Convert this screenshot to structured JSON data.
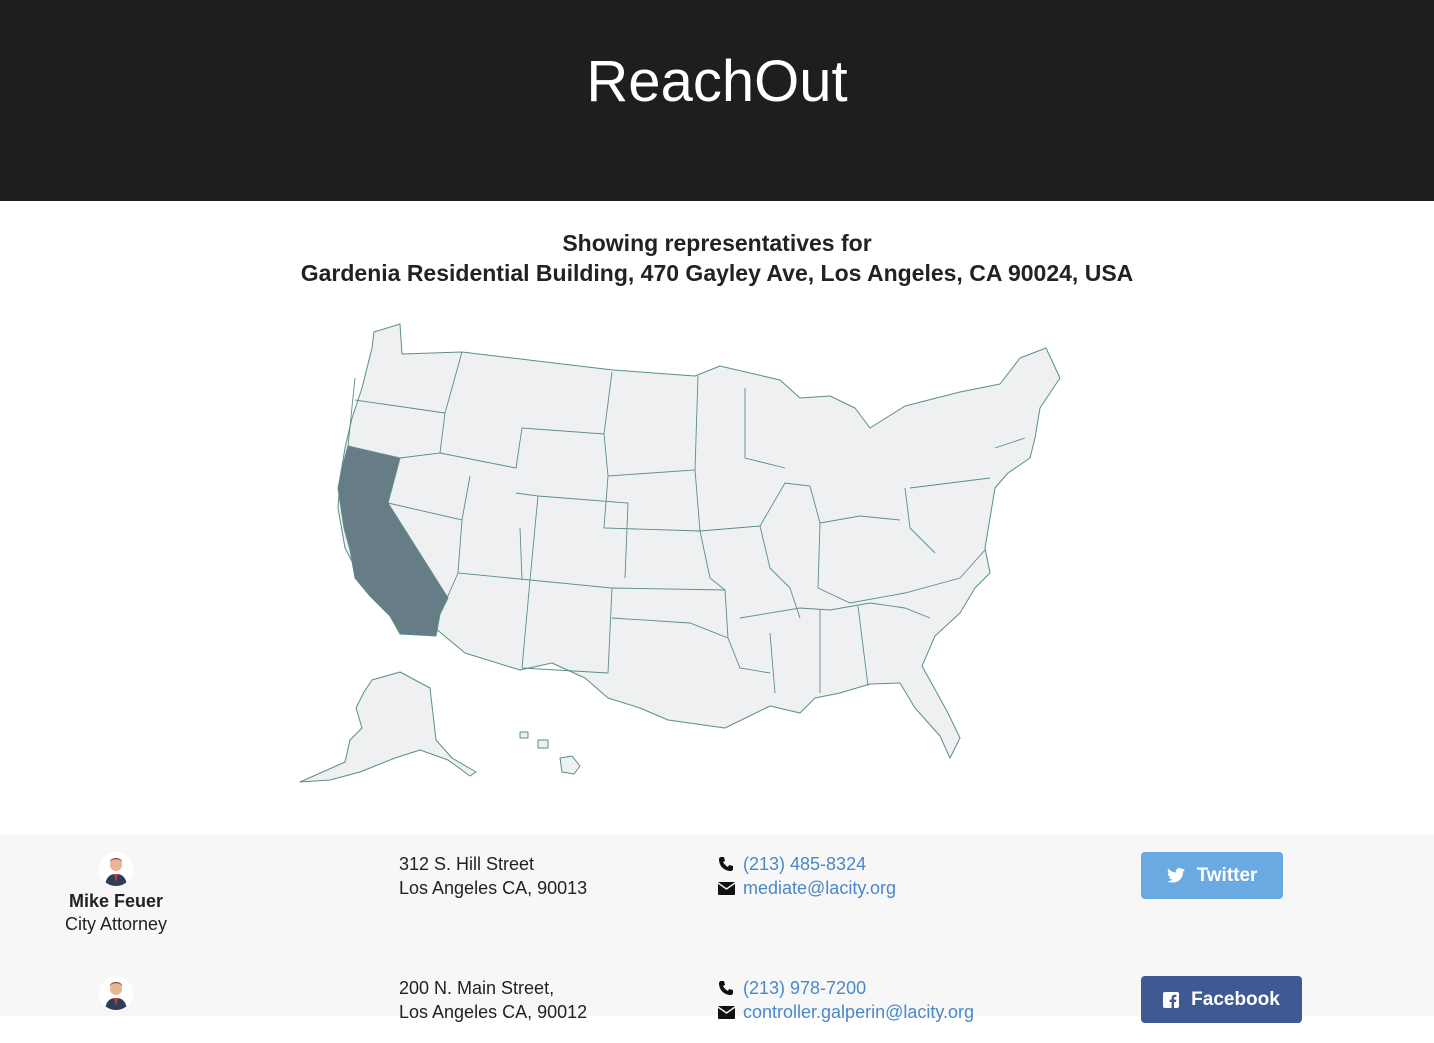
{
  "app": {
    "title": "ReachOut"
  },
  "location": {
    "line1": "Showing representatives for",
    "line2": "Gardenia Residential Building, 470 Gayley Ave, Los Angeles, CA 90024, USA"
  },
  "map": {
    "selected_state": "California",
    "selected_color": "#667c87",
    "base_color": "#eef0f2",
    "border_color": "#5a8f87"
  },
  "representatives": [
    {
      "name": "Mike Feuer",
      "title": "City Attorney",
      "address_line1": "312 S. Hill Street",
      "address_line2": "Los Angeles CA, 90013",
      "phone": "(213) 485-8324",
      "email": "mediate@lacity.org",
      "social": {
        "label": "Twitter",
        "icon": "twitter-icon",
        "color": "#6aa9e2"
      }
    },
    {
      "name": "",
      "title": "",
      "address_line1": "200 N. Main Street,",
      "address_line2": "Los Angeles CA, 90012",
      "phone": "(213) 978-7200",
      "email": "controller.galperin@lacity.org",
      "social": {
        "label": "Facebook",
        "icon": "facebook-icon",
        "color": "#3f5a93"
      }
    }
  ]
}
